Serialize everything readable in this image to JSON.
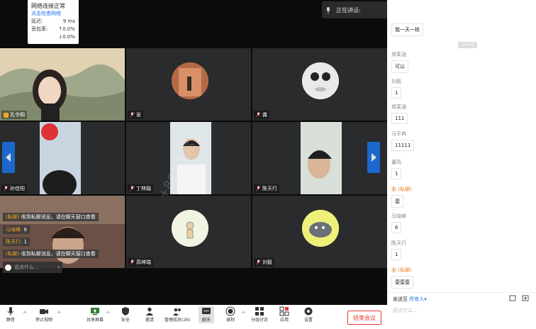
{
  "network": {
    "title": "网络连接正常",
    "link": "点击检查网络",
    "latency_label": "延迟:",
    "latency_value": "9 ms",
    "loss_label": "丢包率:",
    "loss_up": "↑0.0%",
    "loss_down": "↓0.0%"
  },
  "speaking": {
    "label": "正在讲话:"
  },
  "tiles": [
    {
      "name": "孔令桐"
    },
    {
      "name": "张"
    },
    {
      "name": "龚"
    },
    {
      "name": "孙佳阳"
    },
    {
      "name": "丁林融"
    },
    {
      "name": "陈天行"
    },
    {
      "name": "高坤瑞"
    },
    {
      "name": "高坤瑞"
    },
    {
      "name": "刘毅"
    }
  ],
  "watermark": "+86 139615",
  "chat_overlay": [
    {
      "name": "(私聊)",
      "text": "收到私聊消息，请在聊天窗口查看"
    },
    {
      "name": "马培峰:",
      "text": "6"
    },
    {
      "name": "陈天行:",
      "text": "1"
    },
    {
      "name": "(私聊)",
      "text": "收到私聊消息，请在聊天窗口查看"
    }
  ],
  "chat_input_placeholder": "说点什么...",
  "toolbar": {
    "mute": "静音",
    "video": "停止视频",
    "share": "共享屏幕",
    "security": "安全",
    "invite": "邀请",
    "members": "管理成员(26)",
    "chat": "聊天",
    "record": "录制",
    "breakout": "分组讨论",
    "apps": "应用",
    "settings": "设置",
    "end": "结束会议"
  },
  "chat_panel": {
    "messages": [
      {
        "name": "",
        "text": "我一天一核",
        "private": false
      },
      {
        "name": "郑茉涵",
        "text": "可以",
        "private": false
      },
      {
        "name": "刘毅",
        "text": "1",
        "private": false
      },
      {
        "name": "郑茉涵",
        "text": "111",
        "private": false
      },
      {
        "name": "马平冉",
        "text": "11111",
        "private": false
      },
      {
        "name": "董鸣",
        "text": "1",
        "private": false
      },
      {
        "name": "张 (私聊)",
        "text": "壹",
        "private": true
      },
      {
        "name": "马培峰",
        "text": "6",
        "private": false
      },
      {
        "name": "陈天行",
        "text": "1",
        "private": false
      },
      {
        "name": "张 (私聊)",
        "text": "壹壹壹",
        "private": true
      }
    ],
    "timestamp": "16:44",
    "send_to_label": "发送至",
    "send_to_value": "所有人▾",
    "input_placeholder": "说点什么..."
  }
}
